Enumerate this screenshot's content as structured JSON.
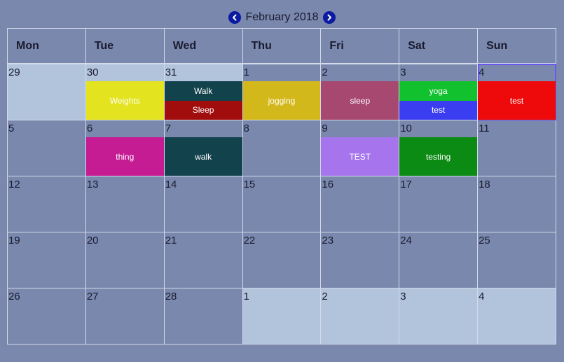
{
  "header": {
    "month_title": "February 2018",
    "prev_icon": "chevron-left-icon",
    "next_icon": "chevron-right-icon"
  },
  "weekdays": [
    "Mon",
    "Tue",
    "Wed",
    "Thu",
    "Fri",
    "Sat",
    "Sun"
  ],
  "weeks": [
    [
      {
        "day": "29",
        "other": true
      },
      {
        "day": "30",
        "other": true,
        "events": [
          {
            "title": "Weights",
            "color": "#e3e31f",
            "text_color": "#ffffff"
          }
        ]
      },
      {
        "day": "31",
        "other": true,
        "events": [
          {
            "title": "Walk",
            "color": "#12424c"
          },
          {
            "title": "Sleep",
            "color": "#a10d0d"
          }
        ]
      },
      {
        "day": "1",
        "events": [
          {
            "title": "jogging",
            "color": "#d3b81b"
          }
        ]
      },
      {
        "day": "2",
        "events": [
          {
            "title": "sleep",
            "color": "#a64870"
          }
        ]
      },
      {
        "day": "3",
        "events": [
          {
            "title": "yoga",
            "color": "#12c12e"
          },
          {
            "title": "test",
            "color": "#3b3df0"
          }
        ]
      },
      {
        "day": "4",
        "today": true,
        "events": [
          {
            "title": "test",
            "color": "#ee0a0a"
          }
        ]
      }
    ],
    [
      {
        "day": "5"
      },
      {
        "day": "6",
        "events": [
          {
            "title": "thing",
            "color": "#c51b93"
          }
        ]
      },
      {
        "day": "7",
        "events": [
          {
            "title": "walk",
            "color": "#12424c"
          }
        ]
      },
      {
        "day": "8"
      },
      {
        "day": "9",
        "events": [
          {
            "title": "TEST",
            "color": "#a674ec"
          }
        ]
      },
      {
        "day": "10",
        "events": [
          {
            "title": "testing",
            "color": "#0b8a14"
          }
        ]
      },
      {
        "day": "11"
      }
    ],
    [
      {
        "day": "12"
      },
      {
        "day": "13"
      },
      {
        "day": "14"
      },
      {
        "day": "15"
      },
      {
        "day": "16"
      },
      {
        "day": "17"
      },
      {
        "day": "18"
      }
    ],
    [
      {
        "day": "19"
      },
      {
        "day": "20"
      },
      {
        "day": "21"
      },
      {
        "day": "22"
      },
      {
        "day": "23"
      },
      {
        "day": "24"
      },
      {
        "day": "25"
      }
    ],
    [
      {
        "day": "26"
      },
      {
        "day": "27"
      },
      {
        "day": "28"
      },
      {
        "day": "1",
        "other": true
      },
      {
        "day": "2",
        "other": true
      },
      {
        "day": "3",
        "other": true
      },
      {
        "day": "4",
        "other": true
      }
    ]
  ]
}
